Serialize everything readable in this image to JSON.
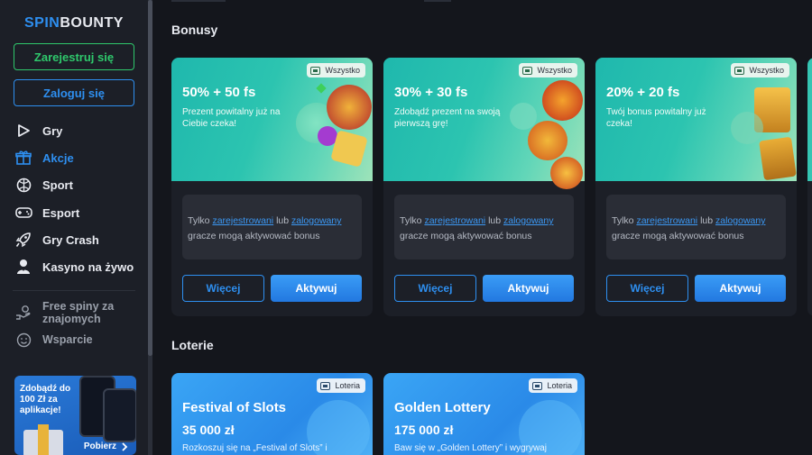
{
  "brand": {
    "part1": "SPIN",
    "part2": "BOUNTY"
  },
  "auth": {
    "register_label": "Zarejestruj się",
    "login_label": "Zaloguj się"
  },
  "nav": {
    "items": [
      {
        "label": "Gry",
        "icon": "play-icon"
      },
      {
        "label": "Akcje",
        "icon": "gift-icon",
        "active": true
      },
      {
        "label": "Sport",
        "icon": "ball-icon"
      },
      {
        "label": "Esport",
        "icon": "gamepad-icon"
      },
      {
        "label": "Gry Crash",
        "icon": "rocket-icon"
      },
      {
        "label": "Kasyno na żywo",
        "icon": "dealer-icon"
      }
    ],
    "secondary": [
      {
        "label": "Free spiny za znajomych",
        "icon": "hand-coin-icon"
      },
      {
        "label": "Wsparcie",
        "icon": "smile-icon"
      }
    ]
  },
  "app_promo": {
    "text": "Zdobądź do 100 Zł za aplikacje!",
    "cta": "Pobierz"
  },
  "sections": {
    "bonuses": "Bonusy",
    "lotteries": "Loterie"
  },
  "bonuses": [
    {
      "badge": "Wszystko",
      "title": "50% + 50 fs",
      "desc": "Prezent powitalny już na Ciebie czeka!",
      "info_prefix": "Tylko",
      "link1": "zarejestrowani",
      "mid": "lub",
      "link2": "zalogowany",
      "info_suffix": "gracze mogą aktywować bonus",
      "more": "Więcej",
      "activate": "Aktywuj"
    },
    {
      "badge": "Wszystko",
      "title": "30% + 30 fs",
      "desc": "Zdobądź prezent na swoją pierwszą grę!",
      "info_prefix": "Tylko",
      "link1": "zarejestrowani",
      "mid": "lub",
      "link2": "zalogowany",
      "info_suffix": "gracze mogą aktywować bonus",
      "more": "Więcej",
      "activate": "Aktywuj"
    },
    {
      "badge": "Wszystko",
      "title": "20% + 20 fs",
      "desc": "Twój bonus powitalny już czeka!",
      "info_prefix": "Tylko",
      "link1": "zarejestrowani",
      "mid": "lub",
      "link2": "zalogowany",
      "info_suffix": "gracze mogą aktywować bonus",
      "more": "Więcej",
      "activate": "Aktywuj"
    }
  ],
  "lotteries": [
    {
      "badge": "Loteria",
      "title": "Festival of Slots",
      "amount": "35 000 zł",
      "desc": "Rozkoszuj się na „Festival of Slots” i"
    },
    {
      "badge": "Loteria",
      "title": "Golden Lottery",
      "amount": "175 000 zł",
      "desc": "Baw się w „Golden Lottery” i wygrywaj"
    }
  ],
  "colors": {
    "accent": "#2e8ff0",
    "green": "#2fc86c",
    "sidebar": "#1c1f27",
    "bg": "#14161c"
  }
}
